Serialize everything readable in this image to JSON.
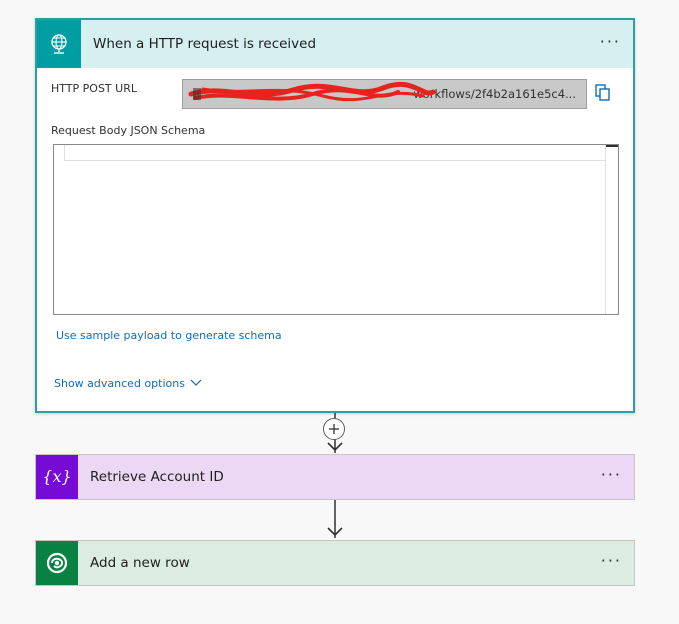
{
  "trigger": {
    "title": "When a HTTP request is received",
    "more": "···",
    "url_label": "HTTP POST URL",
    "url_value": "workflows/2f4b2a161e5c4...",
    "schema_label": "Request Body JSON Schema",
    "sample_link": "Use sample payload to generate schema",
    "advanced_link": "Show advanced options",
    "icons": {
      "header": "globe-network-icon",
      "copy": "copy-icon",
      "advanced": "chevron-down-icon"
    }
  },
  "connector": {
    "icons": [
      "plus-icon",
      "arrow-down-icon"
    ]
  },
  "actions": [
    {
      "title": "Retrieve Account ID",
      "more": "···",
      "icon": "variable-icon",
      "accent": "#770bd6"
    },
    {
      "title": "Add a new row",
      "more": "···",
      "icon": "dataverse-icon",
      "accent": "#088142"
    }
  ],
  "colors": {
    "trigger_accent": "#009ea2",
    "trigger_header_bg": "#d6eff0",
    "link": "#0f6cbd",
    "redaction": "#e8231e"
  }
}
